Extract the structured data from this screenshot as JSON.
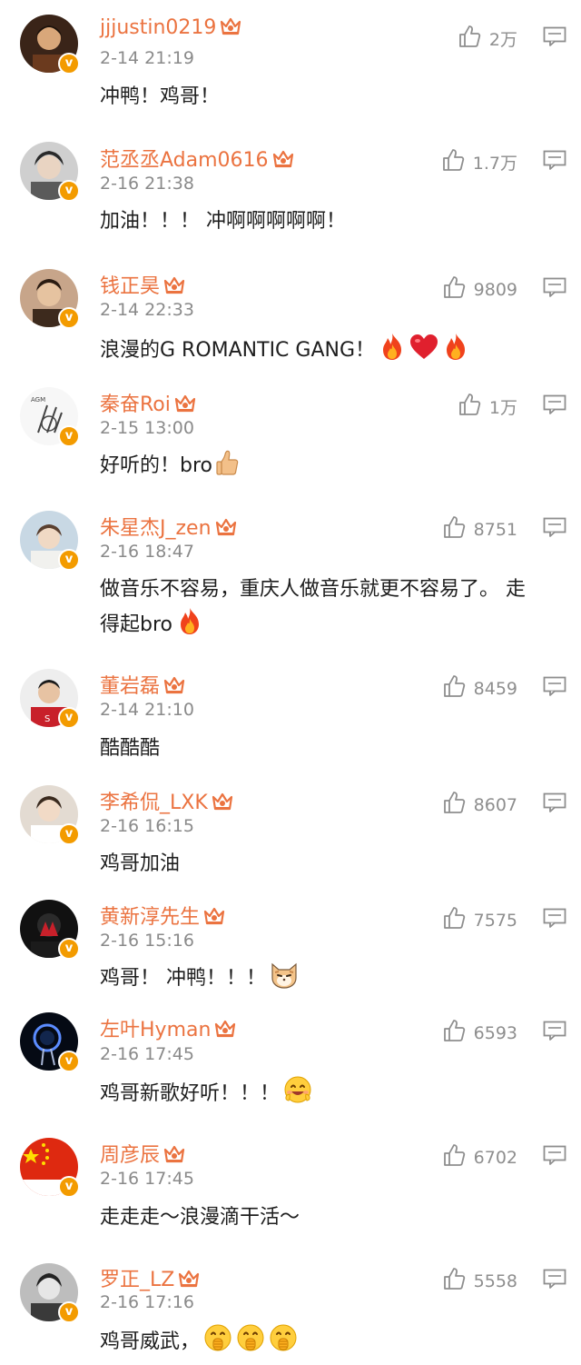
{
  "comments": [
    {
      "name": "jjjustin0219",
      "time": "2-14 21:19",
      "text": "冲鸭！鸡哥！",
      "emojis": [],
      "likes": "2万",
      "avatar_color": "#6b3a1e"
    },
    {
      "name": "范丞丞Adam0616",
      "time": "2-16 21:38",
      "text": "加油！！！ 冲啊啊啊啊啊！",
      "emojis": [],
      "likes": "1.7万",
      "avatar_color": "#5a5a5a"
    },
    {
      "name": "钱正昊",
      "time": "2-14 22:33",
      "text": "浪漫的G ROMANTIC GANG！",
      "emojis": [
        "fire-emoji",
        "heart-emoji",
        "fire-emoji"
      ],
      "likes": "9809",
      "avatar_color": "#9c7b5a"
    },
    {
      "name": "秦奋Roi",
      "time": "2-15 13:00",
      "text": "好听的！bro",
      "emojis": [
        "thumbs-up-emoji"
      ],
      "likes": "1万",
      "avatar_color": "#e8e8e8"
    },
    {
      "name": "朱星杰J_zen",
      "time": "2-16 18:47",
      "text": "做音乐不容易，重庆人做音乐就更不容易了。 走得起bro",
      "emojis": [
        "fire-emoji"
      ],
      "likes": "8751",
      "avatar_color": "#b9c9d6"
    },
    {
      "name": "董岩磊",
      "time": "2-14 21:10",
      "text": "酷酷酷",
      "emojis": [],
      "likes": "8459",
      "avatar_color": "#b33a3a"
    },
    {
      "name": "李希侃_LXK",
      "time": "2-16 16:15",
      "text": "鸡哥加油",
      "emojis": [],
      "likes": "8607",
      "avatar_color": "#d9cfc4"
    },
    {
      "name": "黄新淳先生",
      "time": "2-16 15:16",
      "text": "鸡哥！ 冲鸭！！！",
      "emojis": [
        "cat-emoji"
      ],
      "likes": "7575",
      "avatar_color": "#1a1a1a"
    },
    {
      "name": "左叶Hyman",
      "time": "2-16 17:45",
      "text": "鸡哥新歌好听！！！",
      "emojis": [
        "smile-emoji"
      ],
      "likes": "6593",
      "avatar_color": "#0d1a2a"
    },
    {
      "name": "周彦辰",
      "time": "2-16 17:45",
      "text": "走走走～浪漫滴干活～",
      "emojis": [],
      "likes": "6702",
      "avatar_color": "#de2910"
    },
    {
      "name": "罗正_LZ",
      "time": "2-16 17:16",
      "text": "鸡哥威武，",
      "emojis": [
        "cheer-emoji",
        "cheer-emoji",
        "cheer-emoji"
      ],
      "likes": "5558",
      "avatar_color": "#4a4a4a"
    }
  ],
  "badge_label": "v",
  "colors": {
    "name": "#eb7340",
    "badge": "#f39b00",
    "meta": "#8a8a8a"
  }
}
